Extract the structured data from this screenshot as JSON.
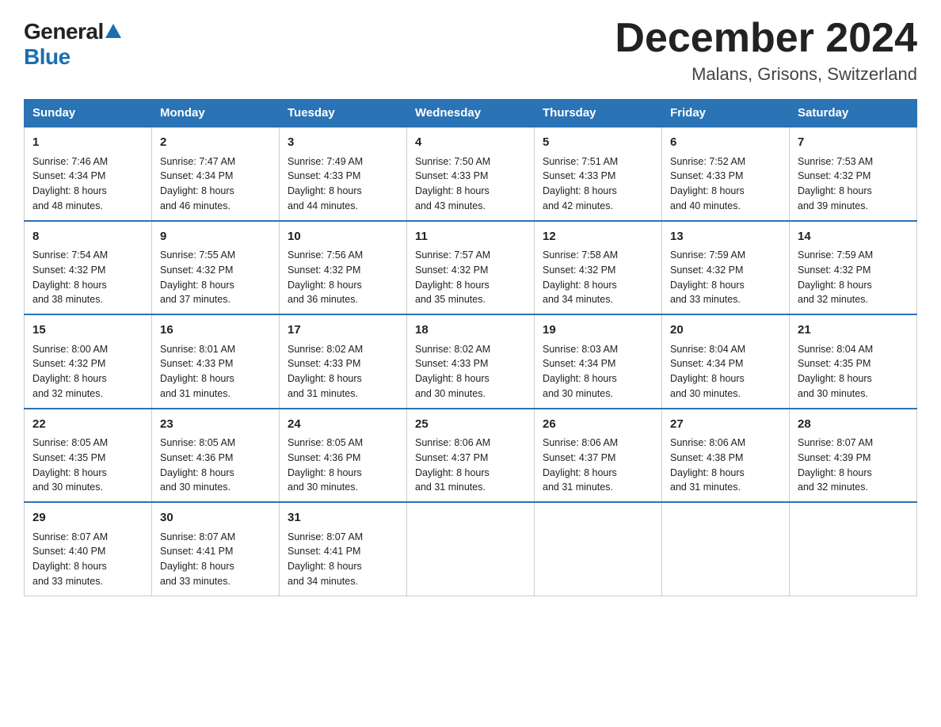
{
  "header": {
    "logo_general": "General",
    "logo_blue": "Blue",
    "month_title": "December 2024",
    "location": "Malans, Grisons, Switzerland"
  },
  "days_of_week": [
    "Sunday",
    "Monday",
    "Tuesday",
    "Wednesday",
    "Thursday",
    "Friday",
    "Saturday"
  ],
  "weeks": [
    [
      {
        "day": "1",
        "sunrise": "7:46 AM",
        "sunset": "4:34 PM",
        "daylight": "8 hours and 48 minutes."
      },
      {
        "day": "2",
        "sunrise": "7:47 AM",
        "sunset": "4:34 PM",
        "daylight": "8 hours and 46 minutes."
      },
      {
        "day": "3",
        "sunrise": "7:49 AM",
        "sunset": "4:33 PM",
        "daylight": "8 hours and 44 minutes."
      },
      {
        "day": "4",
        "sunrise": "7:50 AM",
        "sunset": "4:33 PM",
        "daylight": "8 hours and 43 minutes."
      },
      {
        "day": "5",
        "sunrise": "7:51 AM",
        "sunset": "4:33 PM",
        "daylight": "8 hours and 42 minutes."
      },
      {
        "day": "6",
        "sunrise": "7:52 AM",
        "sunset": "4:33 PM",
        "daylight": "8 hours and 40 minutes."
      },
      {
        "day": "7",
        "sunrise": "7:53 AM",
        "sunset": "4:32 PM",
        "daylight": "8 hours and 39 minutes."
      }
    ],
    [
      {
        "day": "8",
        "sunrise": "7:54 AM",
        "sunset": "4:32 PM",
        "daylight": "8 hours and 38 minutes."
      },
      {
        "day": "9",
        "sunrise": "7:55 AM",
        "sunset": "4:32 PM",
        "daylight": "8 hours and 37 minutes."
      },
      {
        "day": "10",
        "sunrise": "7:56 AM",
        "sunset": "4:32 PM",
        "daylight": "8 hours and 36 minutes."
      },
      {
        "day": "11",
        "sunrise": "7:57 AM",
        "sunset": "4:32 PM",
        "daylight": "8 hours and 35 minutes."
      },
      {
        "day": "12",
        "sunrise": "7:58 AM",
        "sunset": "4:32 PM",
        "daylight": "8 hours and 34 minutes."
      },
      {
        "day": "13",
        "sunrise": "7:59 AM",
        "sunset": "4:32 PM",
        "daylight": "8 hours and 33 minutes."
      },
      {
        "day": "14",
        "sunrise": "7:59 AM",
        "sunset": "4:32 PM",
        "daylight": "8 hours and 32 minutes."
      }
    ],
    [
      {
        "day": "15",
        "sunrise": "8:00 AM",
        "sunset": "4:32 PM",
        "daylight": "8 hours and 32 minutes."
      },
      {
        "day": "16",
        "sunrise": "8:01 AM",
        "sunset": "4:33 PM",
        "daylight": "8 hours and 31 minutes."
      },
      {
        "day": "17",
        "sunrise": "8:02 AM",
        "sunset": "4:33 PM",
        "daylight": "8 hours and 31 minutes."
      },
      {
        "day": "18",
        "sunrise": "8:02 AM",
        "sunset": "4:33 PM",
        "daylight": "8 hours and 30 minutes."
      },
      {
        "day": "19",
        "sunrise": "8:03 AM",
        "sunset": "4:34 PM",
        "daylight": "8 hours and 30 minutes."
      },
      {
        "day": "20",
        "sunrise": "8:04 AM",
        "sunset": "4:34 PM",
        "daylight": "8 hours and 30 minutes."
      },
      {
        "day": "21",
        "sunrise": "8:04 AM",
        "sunset": "4:35 PM",
        "daylight": "8 hours and 30 minutes."
      }
    ],
    [
      {
        "day": "22",
        "sunrise": "8:05 AM",
        "sunset": "4:35 PM",
        "daylight": "8 hours and 30 minutes."
      },
      {
        "day": "23",
        "sunrise": "8:05 AM",
        "sunset": "4:36 PM",
        "daylight": "8 hours and 30 minutes."
      },
      {
        "day": "24",
        "sunrise": "8:05 AM",
        "sunset": "4:36 PM",
        "daylight": "8 hours and 30 minutes."
      },
      {
        "day": "25",
        "sunrise": "8:06 AM",
        "sunset": "4:37 PM",
        "daylight": "8 hours and 31 minutes."
      },
      {
        "day": "26",
        "sunrise": "8:06 AM",
        "sunset": "4:37 PM",
        "daylight": "8 hours and 31 minutes."
      },
      {
        "day": "27",
        "sunrise": "8:06 AM",
        "sunset": "4:38 PM",
        "daylight": "8 hours and 31 minutes."
      },
      {
        "day": "28",
        "sunrise": "8:07 AM",
        "sunset": "4:39 PM",
        "daylight": "8 hours and 32 minutes."
      }
    ],
    [
      {
        "day": "29",
        "sunrise": "8:07 AM",
        "sunset": "4:40 PM",
        "daylight": "8 hours and 33 minutes."
      },
      {
        "day": "30",
        "sunrise": "8:07 AM",
        "sunset": "4:41 PM",
        "daylight": "8 hours and 33 minutes."
      },
      {
        "day": "31",
        "sunrise": "8:07 AM",
        "sunset": "4:41 PM",
        "daylight": "8 hours and 34 minutes."
      },
      null,
      null,
      null,
      null
    ]
  ],
  "labels": {
    "sunrise": "Sunrise:",
    "sunset": "Sunset:",
    "daylight": "Daylight:"
  }
}
